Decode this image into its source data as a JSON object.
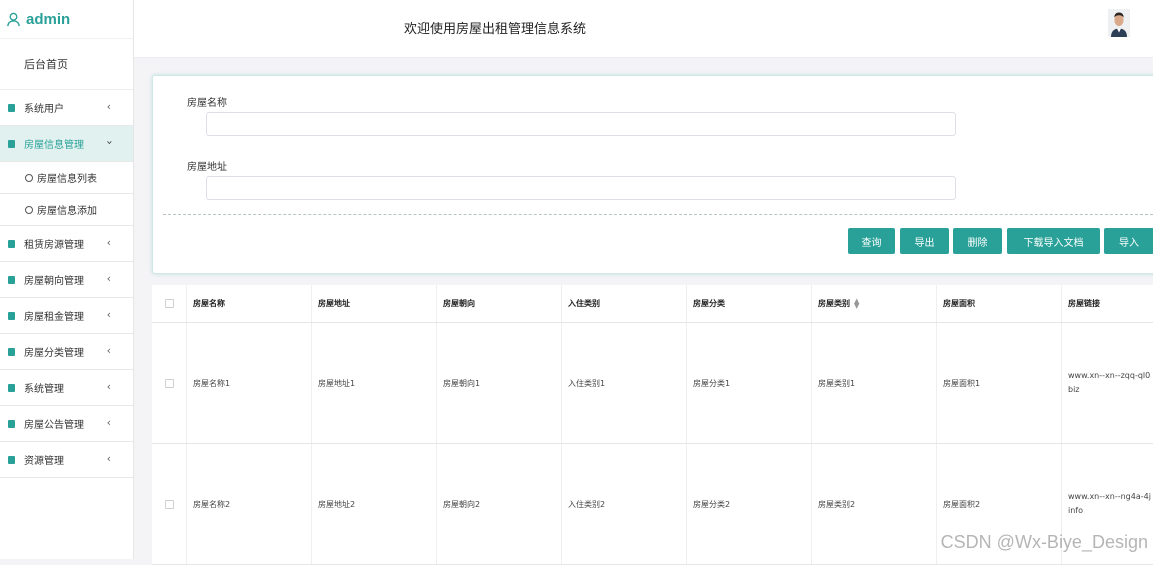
{
  "brand": {
    "name": "admin",
    "accent": "#2aa198"
  },
  "header": {
    "title": "欢迎使用房屋出租管理信息系统"
  },
  "sidebar": {
    "home": "后台首页",
    "items": [
      {
        "label": "系统用户"
      },
      {
        "label": "房屋信息管理",
        "expanded": true,
        "children": [
          "房屋信息列表",
          "房屋信息添加"
        ]
      },
      {
        "label": "租赁房源管理"
      },
      {
        "label": "房屋朝向管理"
      },
      {
        "label": "房屋租金管理"
      },
      {
        "label": "房屋分类管理"
      },
      {
        "label": "系统管理"
      },
      {
        "label": "房屋公告管理"
      },
      {
        "label": "资源管理"
      }
    ]
  },
  "search": {
    "fields": [
      {
        "label": "房屋名称",
        "value": ""
      },
      {
        "label": "房屋地址",
        "value": ""
      }
    ],
    "buttons": [
      "查询",
      "导出",
      "删除",
      "下载导入文档",
      "导入"
    ]
  },
  "table": {
    "headers": [
      "房屋名称",
      "房屋地址",
      "房屋朝向",
      "入住类别",
      "房屋分类",
      "房屋类别",
      "房屋面积",
      "房屋链接"
    ],
    "rows": [
      [
        "房屋名称1",
        "房屋地址1",
        "房屋朝向1",
        "入住类别1",
        "房屋分类1",
        "房屋类别1",
        "房屋面积1",
        "www.xn--xn--zqq-ql0\nbiz"
      ],
      [
        "房屋名称2",
        "房屋地址2",
        "房屋朝向2",
        "入住类别2",
        "房屋分类2",
        "房屋类别2",
        "房屋面积2",
        "www.xn--xn--ng4a-4j\ninfo"
      ]
    ]
  },
  "watermark": "CSDN @Wx-Biye_Design"
}
